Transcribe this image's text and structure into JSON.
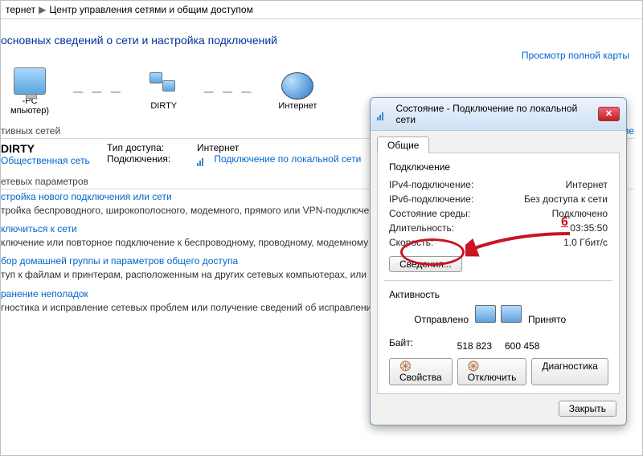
{
  "breadcrumb": {
    "item1": "тернет",
    "item2": "Центр управления сетями и общим доступом"
  },
  "heading": "основных сведений о сети и настройка подключений",
  "map": {
    "pc_label": "-PC",
    "pc_sub": "мпьютер)",
    "middle_label": "DIRTY",
    "inet_label": "Интернет",
    "full_map_link": "Просмотр полной карты"
  },
  "active_header": "тивных сетей",
  "active_right_link": "Подключение или отключение",
  "network": {
    "name": "DIRTY",
    "type": "Общественная сеть",
    "access_label": "Тип доступа:",
    "access_value": "Интернет",
    "conn_label": "Подключения:",
    "conn_value": "Подключение по локальной сети"
  },
  "params_header": "етевых параметров",
  "blocks": {
    "b1_title": "стройка нового подключения или сети",
    "b1_text": "тройка беспроводного, широкополосного, модемного, прямого или VPN-подключения и же настройка маршрутизатора или точки доступа.",
    "b2_title": "ключиться к сети",
    "b2_text": "ключение или повторное подключение к беспроводному, проводному, модемному евому соединению или подключение к VPN.",
    "b3_title": "бор домашней группы и параметров общего доступа",
    "b3_text": "туп к файлам и принтерам, расположенным на других сетевых компьютерах, или нение параметров общего доступа.",
    "b4_title": "ранение неполадок",
    "b4_text": "гностика и исправление сетевых проблем или получение сведений об исправлении."
  },
  "dialog": {
    "title": "Состояние - Подключение по локальной сети",
    "tab": "Общие",
    "group_conn": "Подключение",
    "rows": {
      "ipv4_k": "IPv4-подключение:",
      "ipv4_v": "Интернет",
      "ipv6_k": "IPv6-подключение:",
      "ipv6_v": "Без доступа к сети",
      "media_k": "Состояние среды:",
      "media_v": "Подключено",
      "dur_k": "Длительность:",
      "dur_v": "03:35:50",
      "speed_k": "Скорость:",
      "speed_v": "1.0 Гбит/с"
    },
    "details_btn": "Сведения...",
    "group_act": "Активность",
    "sent_label": "Отправлено",
    "recv_label": "Принято",
    "bytes_label": "Байт:",
    "bytes_sent": "518 823",
    "bytes_recv": "600 458",
    "props_btn": "Свойства",
    "disable_btn": "Отключить",
    "diag_btn": "Диагностика",
    "close_btn": "Закрыть"
  },
  "annotation": "6"
}
